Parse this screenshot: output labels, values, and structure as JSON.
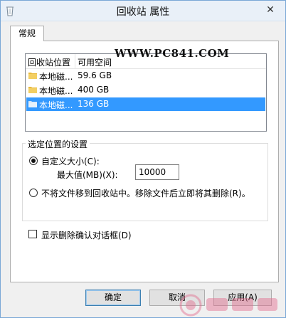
{
  "window": {
    "title": "回收站 属性",
    "close_glyph": "✕"
  },
  "tabs": [
    {
      "label": "常规"
    }
  ],
  "watermark": "WWW.PC841.COM",
  "drive_list": {
    "columns": [
      "回收站位置",
      "可用空间"
    ],
    "rows": [
      {
        "name": "本地磁...",
        "space": "59.6 GB",
        "selected": false
      },
      {
        "name": "本地磁...",
        "space": "400 GB",
        "selected": false
      },
      {
        "name": "本地磁...",
        "space": "136 GB",
        "selected": true
      }
    ]
  },
  "settings": {
    "group_title": "选定位置的设置",
    "custom_size_label": "自定义大小(C):",
    "max_value_label": "最大值(MB)(X):",
    "max_value": "10000",
    "no_recycle_label": "不将文件移到回收站中。移除文件后立即将其删除(R)。",
    "custom_selected": true
  },
  "confirm_delete_label": "显示删除确认对话框(D)",
  "confirm_delete_checked": false,
  "buttons": {
    "ok": "确定",
    "cancel": "取消",
    "apply": "应用(A)"
  },
  "colors": {
    "selection": "#3399ff",
    "folder": "#e8b93c",
    "logo": "#e36a8d"
  }
}
